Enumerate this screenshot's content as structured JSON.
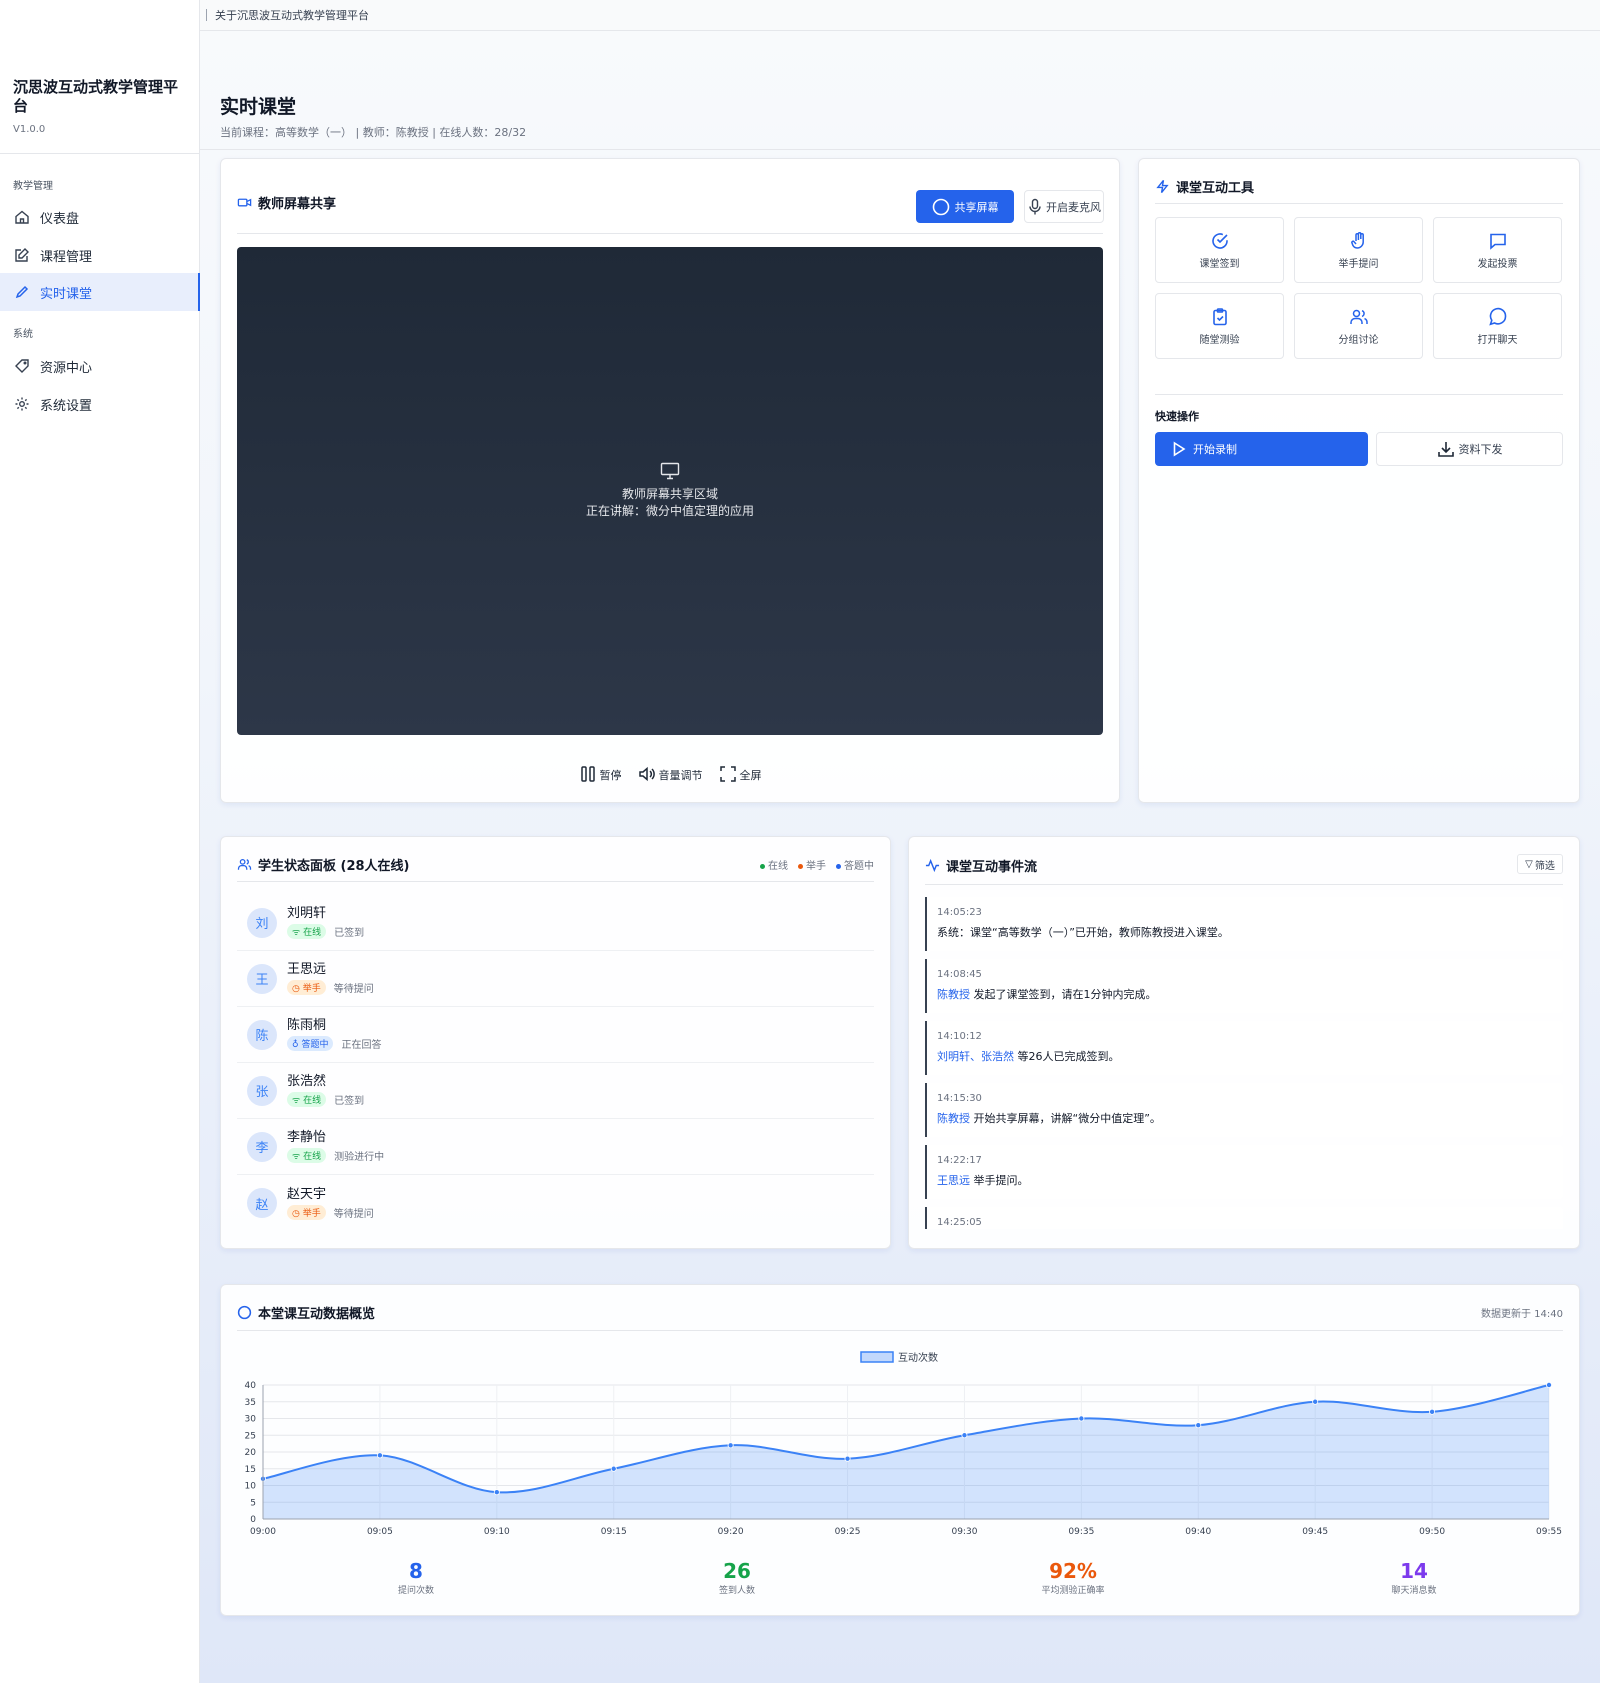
{
  "topbar": {
    "about": "关于沉思波互动式教学管理平台"
  },
  "brand": {
    "title": "沉思波互动式教学管理平台",
    "version": "V1.0.0"
  },
  "sidebar": {
    "group1": "教学管理",
    "group2": "系统",
    "items": [
      {
        "label": "仪表盘",
        "icon": "home-icon"
      },
      {
        "label": "课程管理",
        "icon": "edit-icon"
      },
      {
        "label": "实时课堂",
        "icon": "pencil-icon",
        "active": true
      },
      {
        "label": "资源中心",
        "icon": "tag-icon"
      },
      {
        "label": "系统设置",
        "icon": "gear-icon"
      }
    ]
  },
  "header": {
    "title": "实时课堂",
    "subtitle": "当前课程：高等数学（一） | 教师：陈教授 | 在线人数：28/32"
  },
  "screen_share": {
    "title": "教师屏幕共享",
    "share_button": "共享屏幕",
    "mic_button": "开启麦克风",
    "placeholder_line1": "教师屏幕共享区域",
    "placeholder_line2": "正在讲解：微分中值定理的应用",
    "controls": {
      "pause": "暂停",
      "volume": "音量调节",
      "fullscreen": "全屏"
    }
  },
  "tools": {
    "title": "课堂互动工具",
    "items": [
      {
        "label": "课堂签到",
        "icon": "check-circle-icon"
      },
      {
        "label": "举手提问",
        "icon": "hand-icon"
      },
      {
        "label": "发起投票",
        "icon": "message-square-icon"
      },
      {
        "label": "随堂测验",
        "icon": "clipboard-icon"
      },
      {
        "label": "分组讨论",
        "icon": "users-icon"
      },
      {
        "label": "打开聊天",
        "icon": "chat-bubble-icon"
      }
    ],
    "quick_label": "快速操作",
    "record_button": "开始录制",
    "distribute_button": "资料下发"
  },
  "students": {
    "title": "学生状态面板 (28人在线)",
    "legend": {
      "online": "在线",
      "hand": "举手",
      "answering": "答题中"
    },
    "list": [
      {
        "avatar": "刘",
        "name": "刘明轩",
        "status": "在线",
        "type": "online",
        "note": "已签到"
      },
      {
        "avatar": "王",
        "name": "王思远",
        "status": "举手",
        "type": "hand",
        "note": "等待提问"
      },
      {
        "avatar": "陈",
        "name": "陈雨桐",
        "status": "答题中",
        "type": "answer",
        "note": "正在回答"
      },
      {
        "avatar": "张",
        "name": "张浩然",
        "status": "在线",
        "type": "online",
        "note": "已签到"
      },
      {
        "avatar": "李",
        "name": "李静怡",
        "status": "在线",
        "type": "online",
        "note": "测验进行中"
      },
      {
        "avatar": "赵",
        "name": "赵天宇",
        "status": "举手",
        "type": "hand",
        "note": "等待提问"
      }
    ]
  },
  "events": {
    "title": "课堂互动事件流",
    "filter": "筛选",
    "list": [
      {
        "time": "14:05:23",
        "actor": "",
        "text": "系统：课堂“高等数学（一）”已开始，教师陈教授进入课堂。"
      },
      {
        "time": "14:08:45",
        "actor": "陈教授",
        "text": " 发起了课堂签到，请在1分钟内完成。"
      },
      {
        "time": "14:10:12",
        "actor": "刘明轩、张浩然",
        "text": " 等26人已完成签到。"
      },
      {
        "time": "14:15:30",
        "actor": "陈教授",
        "text": " 开始共享屏幕，讲解“微分中值定理”。"
      },
      {
        "time": "14:22:17",
        "actor": "王思远",
        "text": " 举手提问。"
      },
      {
        "time": "14:25:05",
        "actor": "",
        "text": ""
      }
    ]
  },
  "overview": {
    "title": "本堂课互动数据概览",
    "updated": "数据更新于 14:40",
    "stats": [
      {
        "value": "8",
        "label": "提问次数",
        "color": "#2563eb"
      },
      {
        "value": "26",
        "label": "签到人数",
        "color": "#16a34a"
      },
      {
        "value": "92%",
        "label": "平均测验正确率",
        "color": "#ea580c"
      },
      {
        "value": "14",
        "label": "聊天消息数",
        "color": "#7c3aed"
      }
    ]
  },
  "chart_data": {
    "type": "area",
    "categories": [
      "09:00",
      "09:05",
      "09:10",
      "09:15",
      "09:20",
      "09:25",
      "09:30",
      "09:35",
      "09:40",
      "09:45",
      "09:50",
      "09:55"
    ],
    "series": [
      {
        "name": "互动次数",
        "values": [
          12,
          19,
          8,
          15,
          22,
          18,
          25,
          30,
          28,
          35,
          32,
          40
        ]
      }
    ],
    "yticks": [
      0,
      5,
      10,
      15,
      20,
      25,
      30,
      35,
      40
    ],
    "ylim": [
      0,
      40
    ],
    "grid": true,
    "legend": "top-center",
    "color": "#3b82f6"
  }
}
